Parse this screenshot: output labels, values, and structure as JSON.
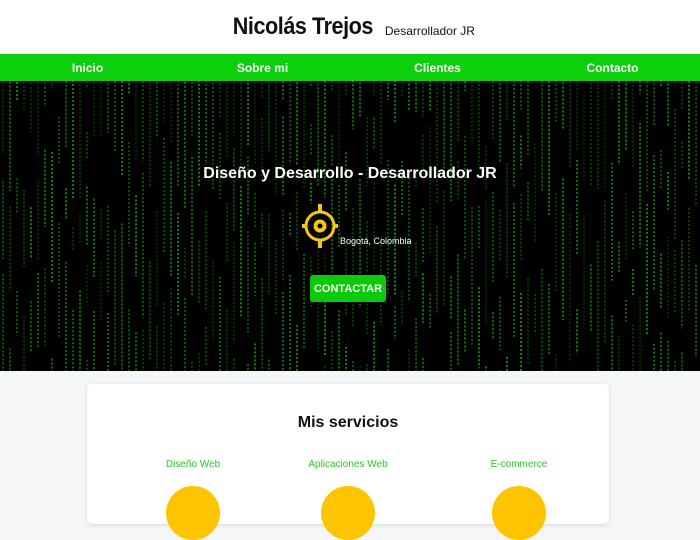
{
  "header": {
    "name": "Nicolás Trejos",
    "role": "Desarrollador JR"
  },
  "nav": {
    "items": [
      "Inicio",
      "Sobre mi",
      "Clientes",
      "Contacto"
    ]
  },
  "hero": {
    "title": "Diseño y Desarrollo - Desarrollador JR",
    "location": "Bogotá, Colombia",
    "location_icon": "target-location-icon",
    "cta_label": "CONTACTAR"
  },
  "services": {
    "title": "Mis servicios",
    "items": [
      "Diseño Web",
      "Aplicaciones Web",
      "E-commerce"
    ]
  },
  "colors": {
    "accent_green": "#0bd00b",
    "service_icon_yellow": "#ffc400",
    "location_icon_yellow": "#f5c518",
    "matrix_green": "#15c815"
  }
}
